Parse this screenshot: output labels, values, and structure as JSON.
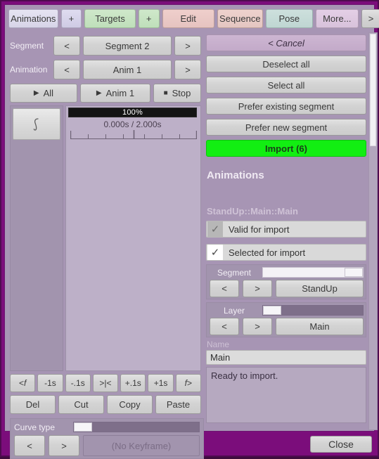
{
  "window": {
    "accent_purple": "#7b0d7b",
    "panel_mauve": "#a795b4",
    "import_green": "#12ee12"
  },
  "tabstrip": {
    "animations_label": "Animations",
    "add_target_group_label": "+",
    "targets_label": "Targets",
    "add_target_label": "+",
    "edit_label": "Edit",
    "sequence_label": "Sequence",
    "pose_label": "Pose",
    "more_label": "More...",
    "next_label": ">"
  },
  "left": {
    "segment": {
      "label": "Segment",
      "prev": "<",
      "value": "Segment 2",
      "next": ">"
    },
    "animation": {
      "label": "Animation",
      "prev": "<",
      "value": "Anim 1",
      "next": ">"
    },
    "transport": {
      "play_all": "All",
      "play_anim": "Anim 1",
      "stop": "Stop",
      "play_glyph": "▶",
      "stop_glyph": "■"
    },
    "timeline": {
      "progress_text": "100%",
      "progress_percent": 100,
      "timecode": "0.000s / 2.000s",
      "current_time": "0.000s",
      "total_time": "2.000s"
    },
    "track": {
      "icon": "curve-icon"
    },
    "keyframe_tools": [
      {
        "label": "<f",
        "italic_tail": true
      },
      {
        "label": "-1s",
        "italic_tail": false
      },
      {
        "label": "-.1s",
        "italic_tail": false
      },
      {
        "label": ">|<",
        "italic_tail": false
      },
      {
        "label": "+.1s",
        "italic_tail": false
      },
      {
        "label": "+1s",
        "italic_tail": false
      },
      {
        "label": "f>",
        "italic_tail": true
      }
    ],
    "kf_prev_frame": "<",
    "kf_prev_frame_f": "f",
    "kf_next_frame_f": "f",
    "kf_next_frame": ">",
    "edit_tools": {
      "delete": "Del",
      "cut": "Cut",
      "copy": "Copy",
      "paste": "Paste"
    },
    "curve_type": {
      "label": "Curve type",
      "prev": "<",
      "next": ">",
      "value": "(No Keyframe)",
      "slider_position_percent": 0
    }
  },
  "right": {
    "cancel_label": "< Cancel",
    "deselect_all_label": "Deselect all",
    "select_all_label": "Select all",
    "prefer_existing_label": "Prefer existing segment",
    "prefer_new_label": "Prefer new segment",
    "import_label": "Import (6)",
    "import_count": 6,
    "section_title": "Animations",
    "item_title": "StandUp::Main::Main",
    "valid_for_import": {
      "label": "Valid for import",
      "checked": true,
      "check_glyph": "✓",
      "enabled": false
    },
    "selected_for_import": {
      "label": "Selected for import",
      "checked": true,
      "check_glyph": "✓",
      "enabled": true
    },
    "segment": {
      "label": "Segment",
      "prev": "<",
      "next": ">",
      "value": "StandUp",
      "slider_position_percent": 100
    },
    "layer": {
      "label": "Layer",
      "prev": "<",
      "next": ">",
      "value": "Main",
      "slider_position_percent": 0
    },
    "name_field": {
      "label": "Name",
      "value": "Main",
      "placeholder": ""
    },
    "status_text": "Ready to import."
  },
  "bottom": {
    "close_label": "Close"
  }
}
